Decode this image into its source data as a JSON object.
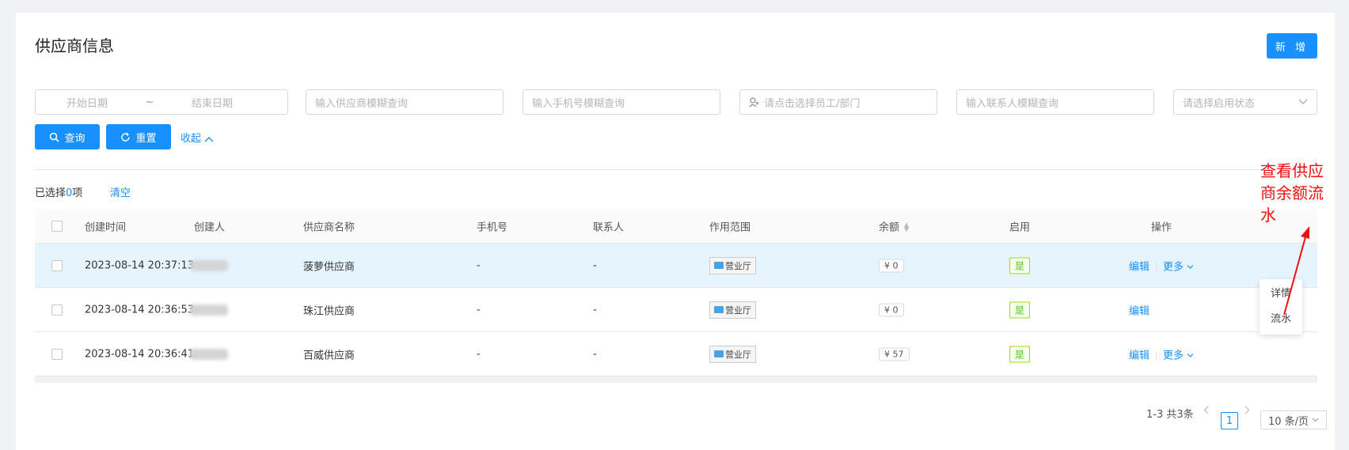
{
  "header": {
    "title": "供应商信息",
    "add_label": "新 增"
  },
  "filters": {
    "start_date_placeholder": "开始日期",
    "range_separator": "~",
    "end_date_placeholder": "结束日期",
    "supplier_placeholder": "输入供应商模糊查询",
    "phone_placeholder": "输入手机号模糊查询",
    "staff_placeholder": "请点击选择员工/部门",
    "contact_placeholder": "输入联系人模糊查询",
    "status_placeholder": "请选择启用状态",
    "search_label": "查询",
    "reset_label": "重置",
    "collapse_label": "收起"
  },
  "selection": {
    "prefix": "已选择",
    "count": "0",
    "suffix": "项",
    "clear_label": "清空"
  },
  "table": {
    "columns": [
      "创建时间",
      "创建人",
      "供应商名称",
      "手机号",
      "联系人",
      "作用范围",
      "余额",
      "启用",
      "操作"
    ],
    "rows": [
      {
        "created": "2023-08-14 20:37:13",
        "name": "菠萝供应商",
        "phone": "-",
        "contact": "-",
        "scope": "营业厅",
        "balance": "¥ 0",
        "enabled": "是",
        "edit": "编辑",
        "more": "更多"
      },
      {
        "created": "2023-08-14 20:36:53",
        "name": "珠江供应商",
        "phone": "-",
        "contact": "-",
        "scope": "营业厅",
        "balance": "¥ 0",
        "enabled": "是",
        "edit": "编辑",
        "more": ""
      },
      {
        "created": "2023-08-14 20:36:41",
        "name": "百威供应商",
        "phone": "-",
        "contact": "-",
        "scope": "营业厅",
        "balance": "¥ 57",
        "enabled": "是",
        "edit": "编辑",
        "more": "更多"
      }
    ]
  },
  "dropdown": {
    "items": [
      "详情",
      "流水"
    ]
  },
  "pagination": {
    "total": "1-3 共3条",
    "current_page": "1",
    "page_size": "10 条/页"
  },
  "annotation": {
    "text": "查看供应商余额流水",
    "color": "#ee1111"
  },
  "colors": {
    "primary": "#1890ff",
    "row_highlight": "#e6f4fd",
    "success": "#52c41a"
  }
}
